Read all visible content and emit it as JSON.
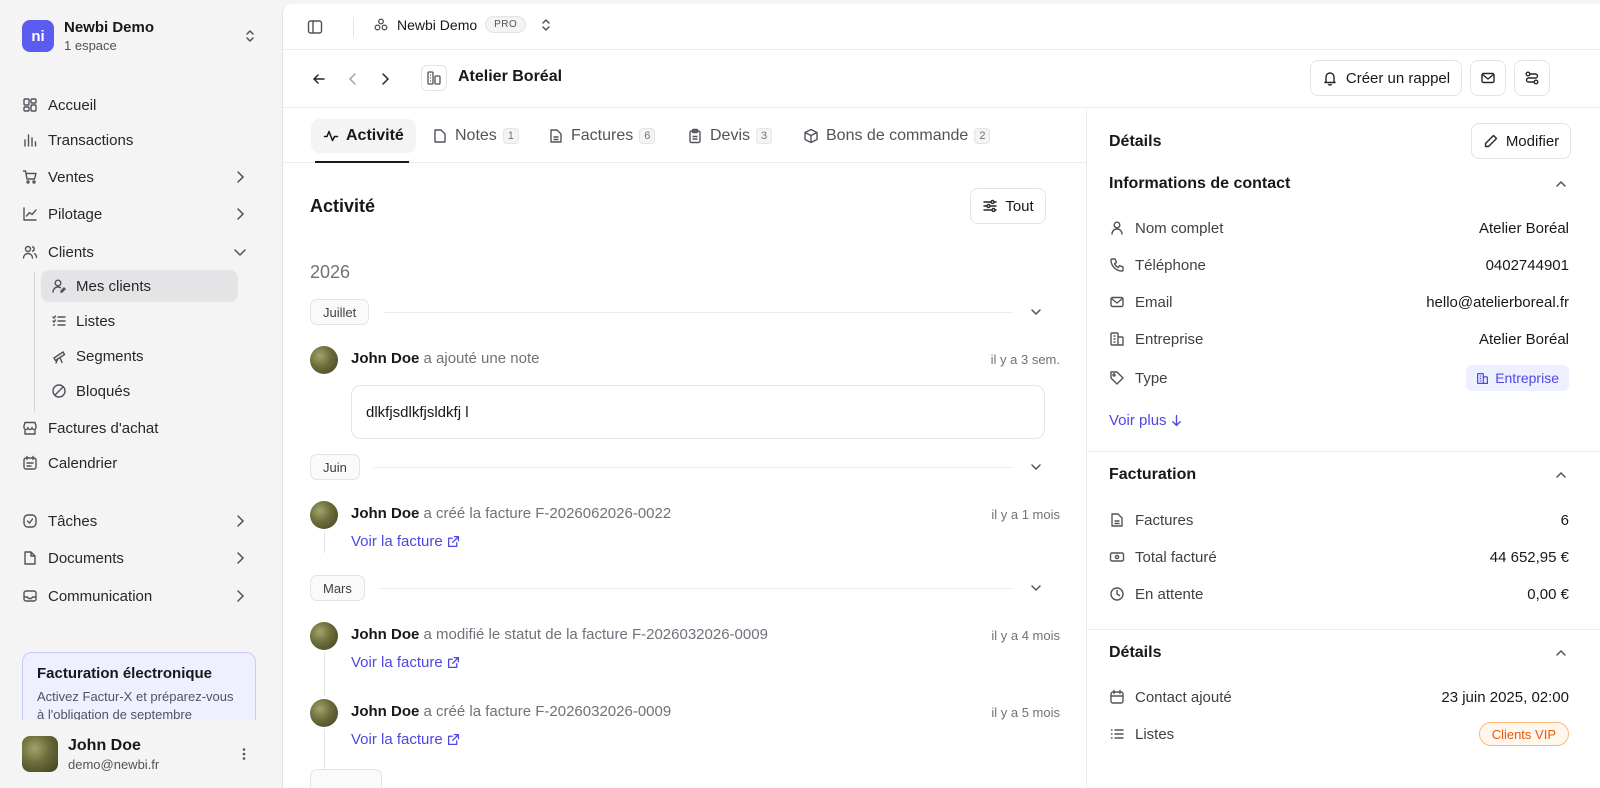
{
  "workspace": {
    "logo": "ni",
    "name": "Newbi Demo",
    "sub": "1 espace"
  },
  "nav": {
    "accueil": "Accueil",
    "transactions": "Transactions",
    "ventes": "Ventes",
    "pilotage": "Pilotage",
    "clients": "Clients",
    "mes_clients": "Mes clients",
    "listes": "Listes",
    "segments": "Segments",
    "bloques": "Bloqués",
    "factures_achat": "Factures d'achat",
    "calendrier": "Calendrier",
    "taches": "Tâches",
    "documents": "Documents",
    "communication": "Communication"
  },
  "promo": {
    "title": "Facturation électronique",
    "text": "Activez Factur-X et préparez-vous à l'obligation de septembre"
  },
  "user": {
    "name": "John Doe",
    "email": "demo@newbi.fr"
  },
  "topbar": {
    "workspace": "Newbi Demo",
    "plan": "PRO"
  },
  "header": {
    "title": "Atelier Boréal",
    "reminder_label": "Créer un rappel"
  },
  "tabs": [
    {
      "label": "Activité",
      "count": ""
    },
    {
      "label": "Notes",
      "count": "1"
    },
    {
      "label": "Factures",
      "count": "6"
    },
    {
      "label": "Devis",
      "count": "3"
    },
    {
      "label": "Bons de commande",
      "count": "2"
    }
  ],
  "activity": {
    "title": "Activité",
    "filter_label": "Tout",
    "year": "2026",
    "months": [
      "Juillet",
      "Juin",
      "Mars"
    ],
    "entries": [
      {
        "user": "John Doe",
        "action": "a ajouté une note",
        "time": "il y a 3 sem.",
        "note": "dlkfjsdlkfjsldkfj l"
      },
      {
        "user": "John Doe",
        "action": "a créé la facture F-2026062026-0022",
        "time": "il y a 1 mois",
        "link": "Voir la facture"
      },
      {
        "user": "John Doe",
        "action": "a modifié le statut de la facture F-2026032026-0009",
        "time": "il y a 4 mois",
        "link": "Voir la facture"
      },
      {
        "user": "John Doe",
        "action": "a créé la facture F-2026032026-0009",
        "time": "il y a 5 mois",
        "link": "Voir la facture"
      }
    ]
  },
  "details": {
    "title": "Détails",
    "edit_label": "Modifier",
    "contact": {
      "title": "Informations de contact",
      "rows": [
        {
          "label": "Nom complet",
          "value": "Atelier Boréal"
        },
        {
          "label": "Téléphone",
          "value": "0402744901"
        },
        {
          "label": "Email",
          "value": "hello@atelierboreal.fr"
        },
        {
          "label": "Entreprise",
          "value": "Atelier Boréal"
        },
        {
          "label": "Type",
          "value": "Entreprise"
        }
      ],
      "more": "Voir plus"
    },
    "billing": {
      "title": "Facturation",
      "rows": [
        {
          "label": "Factures",
          "value": "6"
        },
        {
          "label": "Total facturé",
          "value": "44 652,95 €"
        },
        {
          "label": "En attente",
          "value": "0,00 €"
        }
      ]
    },
    "info": {
      "title": "Détails",
      "rows": [
        {
          "label": "Contact ajouté",
          "value": "23 juin 2025, 02:00"
        },
        {
          "label": "Listes",
          "value": "Clients VIP"
        }
      ]
    }
  },
  "colors": {
    "brand": "#5b5bf0",
    "link": "#4f46e5",
    "vip": "#ea580c"
  }
}
